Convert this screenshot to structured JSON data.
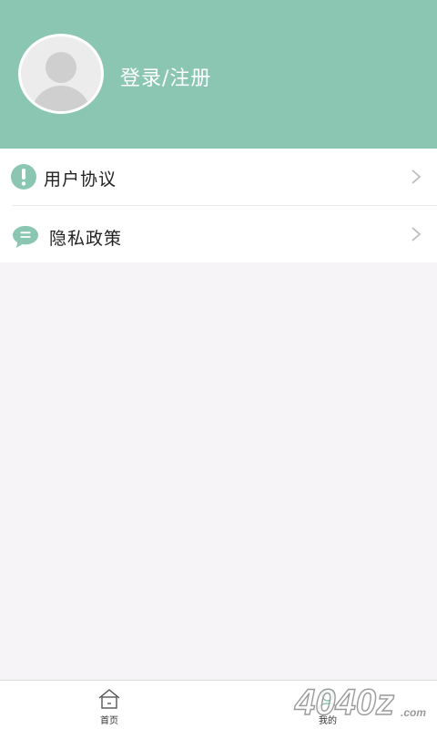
{
  "header": {
    "login_label": "登录/注册",
    "background_color": "#8bc6b3",
    "avatar_icon": "default-user-avatar-icon"
  },
  "menu": {
    "items": [
      {
        "label": "用户协议",
        "icon": "exclamation-circle-icon",
        "trailing_icon": "chevron-right-icon"
      },
      {
        "label": "隐私政策",
        "icon": "chat-bubble-icon",
        "trailing_icon": "chevron-right-icon"
      }
    ],
    "icon_color": "#8bc6b3"
  },
  "tabbar": {
    "tabs": [
      {
        "label": "首页",
        "icon": "home-icon",
        "selected": false
      },
      {
        "label": "我的",
        "icon": "user-icon",
        "selected": true
      }
    ]
  },
  "watermark": {
    "text": "4040z.com"
  }
}
